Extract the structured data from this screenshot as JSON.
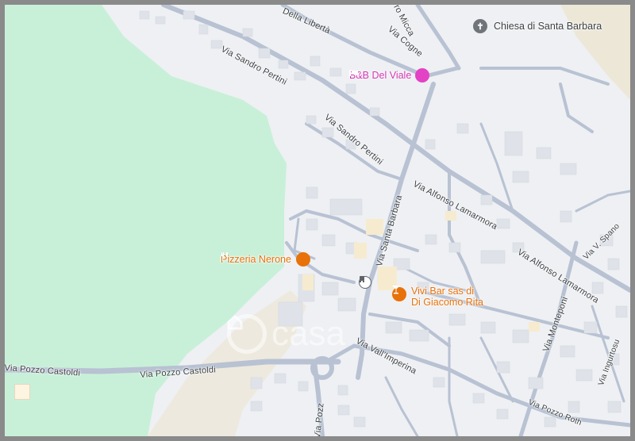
{
  "streets": [
    {
      "id": "della-liberta",
      "label": "Della Libertà"
    },
    {
      "id": "micca",
      "label": "ro Micca"
    },
    {
      "id": "cogne",
      "label": "Via Cogne"
    },
    {
      "id": "pertini-1",
      "label": "Via Sandro Pertini"
    },
    {
      "id": "pertini-2",
      "label": "Via Sandro Pertini"
    },
    {
      "id": "santa-barbara",
      "label": "Via Santa Barbara"
    },
    {
      "id": "lamarmora-1",
      "label": "Via Alfonso Lamarmora"
    },
    {
      "id": "lamarmora-2",
      "label": "Via Alfonso Lamarmora"
    },
    {
      "id": "spano",
      "label": "Via V. Spano"
    },
    {
      "id": "monteponi",
      "label": "Via Monteponi"
    },
    {
      "id": "ingurtosu",
      "label": "Via Ingurtosu"
    },
    {
      "id": "vall-imperina",
      "label": "Via Vall'Imperina"
    },
    {
      "id": "pozzo-castoldi-1",
      "label": "Via Pozzo Castoldi"
    },
    {
      "id": "pozzo-castoldi-2",
      "label": "Via Pozzo Castoldi"
    },
    {
      "id": "pozzo-roth",
      "label": "Via Pozzo Roth"
    },
    {
      "id": "via-pozzo-bottom",
      "label": "Via Pozz"
    }
  ],
  "pois": {
    "church": {
      "label": "Chiesa di Santa Barbara",
      "icon": "cross-icon",
      "color": "#70757a"
    },
    "bnb": {
      "label": "B&B Del Viale",
      "icon": "bed-icon",
      "color": "#e442c4"
    },
    "pizzeria": {
      "label": "Pizzeria Nerone",
      "icon": "fork-knife-icon",
      "color": "#e8710a"
    },
    "bar": {
      "label_line1": "Vivi Bar sas di",
      "label_line2": "Di Giacomo Rita",
      "icon": "cocktail-icon",
      "color": "#e8710a"
    }
  },
  "transit": {
    "icon": "bus-stop-icon"
  },
  "watermark": {
    "text": "casa"
  },
  "colors": {
    "park": "#c8f0d8",
    "road": "#b8c2d3",
    "land": "#eef0f3",
    "sand": "#ede7d8",
    "building": "#e2e5ea"
  }
}
